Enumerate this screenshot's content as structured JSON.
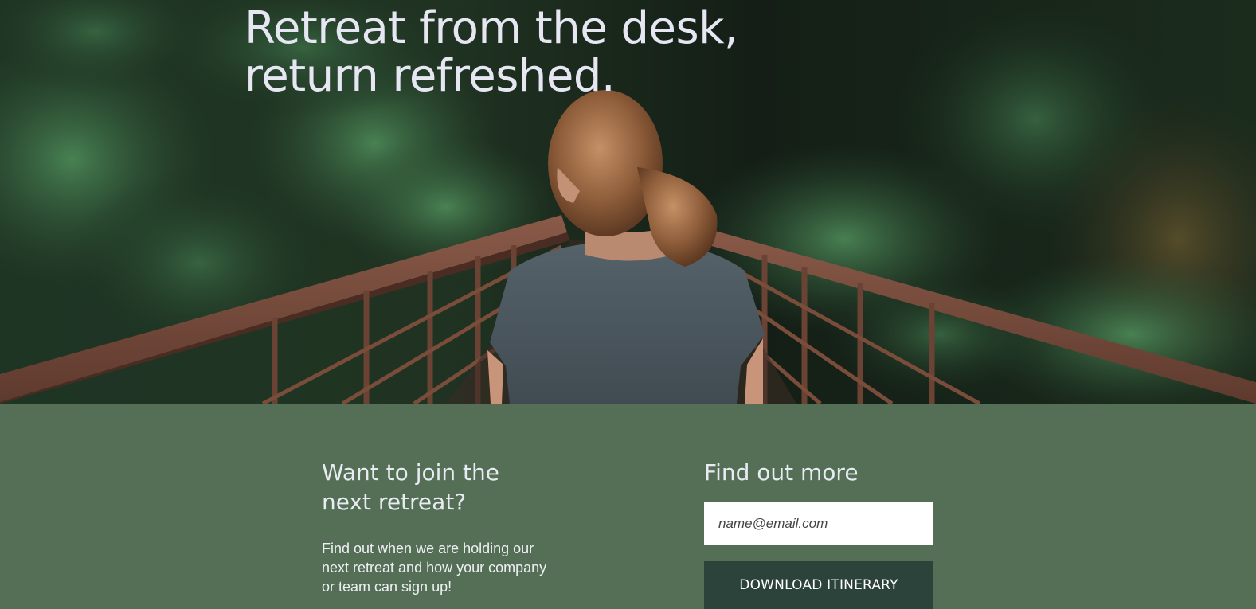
{
  "hero": {
    "title_line1": "Retreat from the desk,",
    "title_line2": "return refreshed.",
    "photo": "woman-on-forest-bridge"
  },
  "join": {
    "heading": "Want to join the next retreat?",
    "text": "Find out when we are holding our next retreat and how your company or team can sign up!"
  },
  "find_out": {
    "heading": "Find out more",
    "email_placeholder": "name@email.com",
    "email_value": "",
    "download_label": "DOWNLOAD ITINERARY"
  },
  "colors": {
    "section_bg": "#546f56",
    "button_bg": "#2b433a",
    "heading_text": "#e8ebf2"
  }
}
